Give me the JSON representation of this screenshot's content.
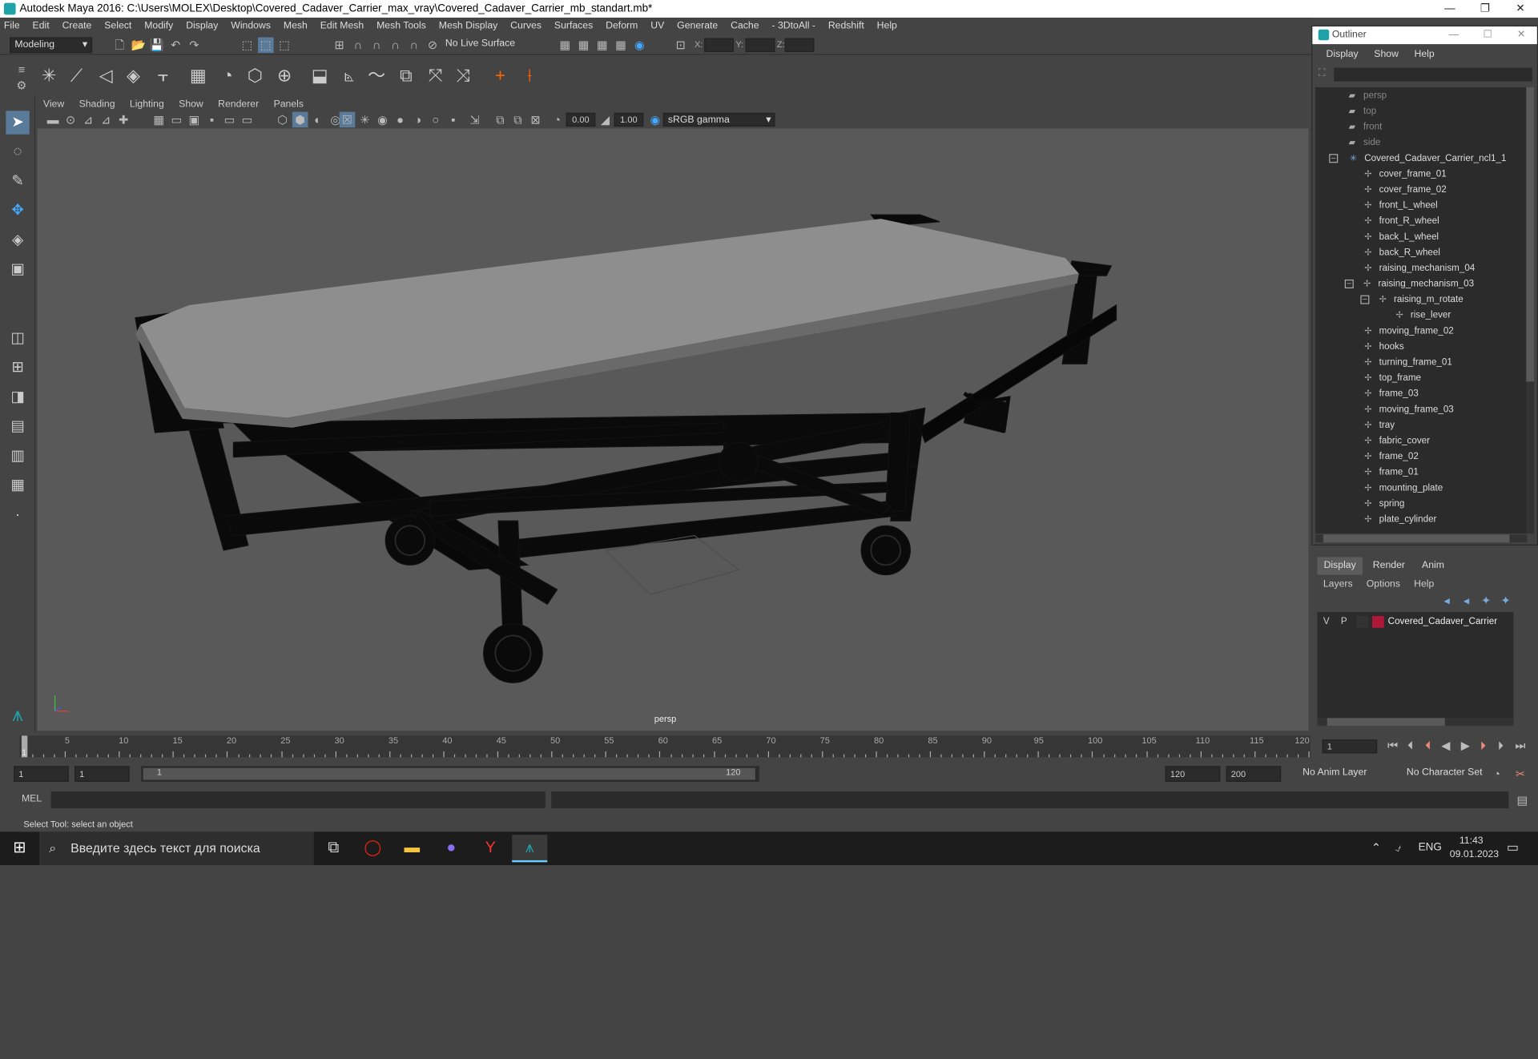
{
  "window": {
    "title": "Autodesk Maya 2016: C:\\Users\\MOLEX\\Desktop\\Covered_Cadaver_Carrier_max_vray\\Covered_Cadaver_Carrier_mb_standart.mb*",
    "minimize": "—",
    "maximize": "❐",
    "close": "✕"
  },
  "menubar": [
    "File",
    "Edit",
    "Create",
    "Select",
    "Modify",
    "Display",
    "Windows",
    "Mesh",
    "Edit Mesh",
    "Mesh Tools",
    "Mesh Display",
    "Curves",
    "Surfaces",
    "Deform",
    "UV",
    "Generate",
    "Cache",
    "- 3DtoAll -",
    "Redshift",
    "Help"
  ],
  "status": {
    "mode": "Modeling",
    "live_surface": "No Live Surface",
    "x_label": "X:",
    "y_label": "Y:",
    "z_label": "Z:"
  },
  "viewport": {
    "menus": [
      "View",
      "Shading",
      "Lighting",
      "Show",
      "Renderer",
      "Panels"
    ],
    "exposure": "0.00",
    "gamma": "1.00",
    "color_space": "sRGB gamma",
    "camera": "persp"
  },
  "outliner": {
    "title": "Outliner",
    "menus": [
      "Display",
      "Show",
      "Help"
    ],
    "cameras": [
      "persp",
      "top",
      "front",
      "side"
    ],
    "root": "Covered_Cadaver_Carrier_ncl1_1",
    "items": [
      "cover_frame_01",
      "cover_frame_02",
      "front_L_wheel",
      "front_R_wheel",
      "back_L_wheel",
      "back_R_wheel",
      "raising_mechanism_04",
      "raising_mechanism_03"
    ],
    "sub": "raising_m_rotate",
    "subsub": "rise_lever",
    "items2": [
      "moving_frame_02",
      "hooks",
      "turning_frame_01",
      "top_frame",
      "frame_03",
      "moving_frame_03",
      "tray",
      "fabric_cover",
      "frame_02",
      "frame_01",
      "mounting_plate",
      "spring",
      "plate_cylinder"
    ]
  },
  "layers": {
    "tabs": [
      "Display",
      "Render",
      "Anim"
    ],
    "menus": [
      "Layers",
      "Options",
      "Help"
    ],
    "row": {
      "v": "V",
      "p": "P",
      "name": "Covered_Cadaver_Carrier",
      "color": "#b0183a"
    }
  },
  "timeline": {
    "ticks": [
      "1",
      "5",
      "10",
      "15",
      "20",
      "25",
      "30",
      "35",
      "40",
      "45",
      "50",
      "55",
      "60",
      "65",
      "70",
      "75",
      "80",
      "85",
      "90",
      "95",
      "100",
      "105",
      "110",
      "115",
      "120"
    ],
    "current": "1"
  },
  "range": {
    "start": "1",
    "start2": "1",
    "slider_start": "1",
    "slider_end": "120",
    "end": "120",
    "end2": "200",
    "anim_layer": "No Anim Layer",
    "char_set": "No Character Set"
  },
  "cmd": {
    "lang": "MEL",
    "help": "Select Tool: select an object"
  },
  "taskbar": {
    "search": "Введите здесь текст для поиска",
    "lang": "ENG",
    "time": "11:43",
    "date": "09.01.2023"
  }
}
